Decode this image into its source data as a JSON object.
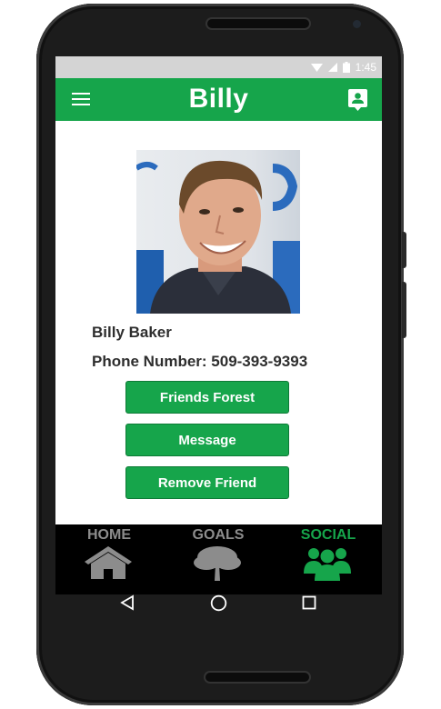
{
  "status_bar": {
    "time": "1:45"
  },
  "app_bar": {
    "title": "Billy"
  },
  "profile": {
    "name": "Billy Baker",
    "phone_label": "Phone Number: 509-393-9393"
  },
  "actions": {
    "friends_forest": "Friends Forest",
    "message": "Message",
    "remove_friend": "Remove Friend"
  },
  "bottom_nav": {
    "home": "HOME",
    "goals": "GOALS",
    "social": "SOCIAL",
    "active": "social"
  },
  "colors": {
    "accent_green": "#16a54b",
    "inactive_gray": "#8c8c8c",
    "status_bar": "#d4d4d4"
  },
  "icons": {
    "app_bar_left": "menu-icon",
    "app_bar_right": "contact-icon",
    "home": "house-icon",
    "goals": "tree-icon",
    "social": "group-icon"
  }
}
